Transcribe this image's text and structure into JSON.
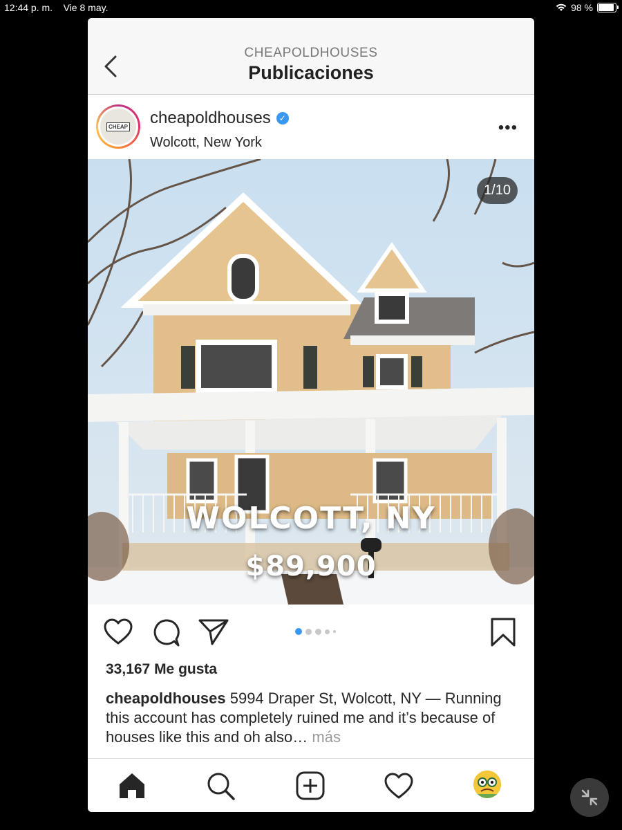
{
  "status_bar": {
    "time": "12:44 p. m.",
    "date": "Vie 8 may.",
    "battery": "98 %",
    "battery_level": 0.98
  },
  "nav": {
    "kicker": "CHEAPOLDHOUSES",
    "title": "Publicaciones",
    "back_icon": "chevron-left-icon"
  },
  "post": {
    "avatar_text": "CHEAP",
    "username": "cheapoldhouses",
    "verified": true,
    "location": "Wolcott, New York",
    "more_icon": "ellipsis-icon",
    "counter": "1/10",
    "overlay_city": "WOLCOTT, NY",
    "overlay_price": "$89,900",
    "carousel_dots": 5,
    "carousel_active": 0,
    "likes": "33,167 Me gusta",
    "caption_user": "cheapoldhouses",
    "caption_text": "5994 Draper St, Wolcott, NY — Running this account has completely ruined me and it’s because of houses like this and oh also…",
    "caption_more": "más"
  },
  "actions": {
    "like_icon": "heart-icon",
    "comment_icon": "comment-icon",
    "share_icon": "send-icon",
    "save_icon": "bookmark-icon"
  },
  "tabbar": {
    "items": [
      "home-icon",
      "search-icon",
      "add-post-icon",
      "activity-heart-icon",
      "profile-avatar"
    ]
  },
  "colors": {
    "accent": "#3897f0",
    "text": "#262626",
    "muted": "#9a9a9a"
  }
}
